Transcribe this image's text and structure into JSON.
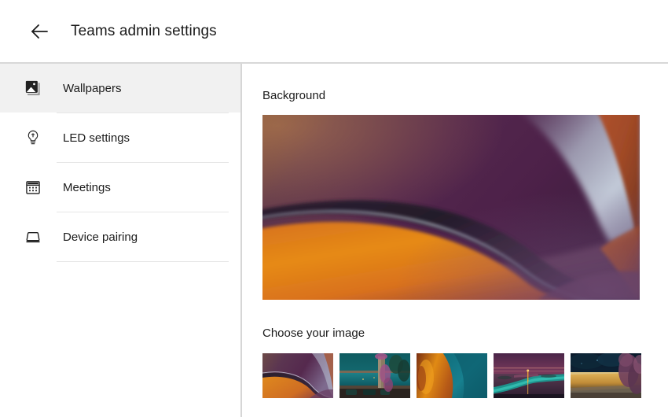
{
  "header": {
    "back_icon": "arrow-left-icon",
    "title": "Teams admin settings"
  },
  "sidebar": {
    "items": [
      {
        "label": "Wallpapers",
        "icon": "image-icon",
        "selected": true
      },
      {
        "label": "LED settings",
        "icon": "lightbulb-icon",
        "selected": false
      },
      {
        "label": "Meetings",
        "icon": "calendar-icon",
        "selected": false
      },
      {
        "label": "Device pairing",
        "icon": "monitor-icon",
        "selected": false
      }
    ]
  },
  "main": {
    "background_label": "Background",
    "choose_label": "Choose your image",
    "preview": {
      "name": "abstract-wave-purple-orange",
      "colors": [
        "#4a2a3c",
        "#6b3a52",
        "#e08a2a",
        "#c8ccd8",
        "#8a4a2a"
      ]
    },
    "thumbnails": [
      {
        "name": "abstract-wave-purple-orange",
        "selected": true
      },
      {
        "name": "seaside-dusk-teal",
        "selected": false
      },
      {
        "name": "abstract-orange-teal",
        "selected": false
      },
      {
        "name": "river-sunset-purple",
        "selected": false
      },
      {
        "name": "night-wall-blossom",
        "selected": false
      }
    ]
  },
  "colors": {
    "selected_nav_bg": "#f1f1f1",
    "divider": "#e6e6e6",
    "text": "#1b1b1b",
    "border": "#d6d6d6"
  }
}
